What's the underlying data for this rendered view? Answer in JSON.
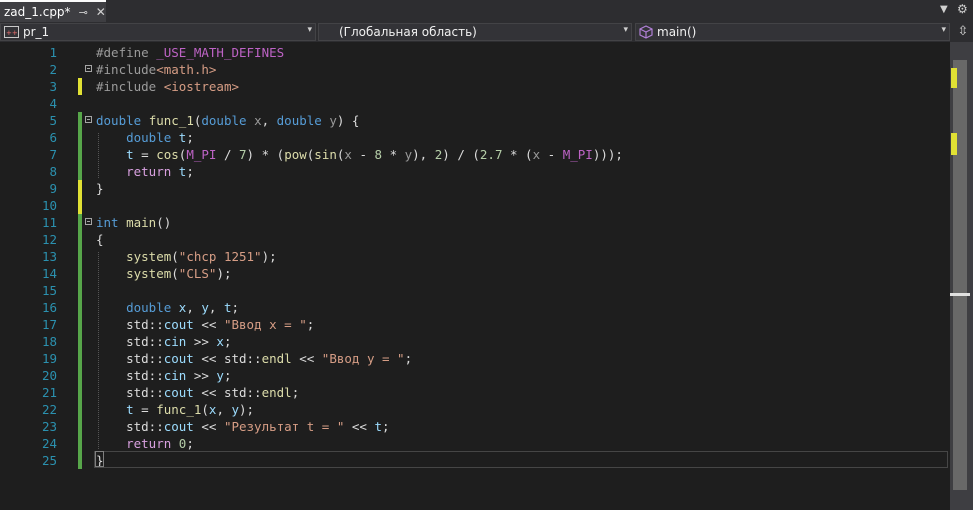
{
  "tab": {
    "title": "zad_1.cpp*",
    "pin_glyph": "⊸",
    "close_glyph": "✕"
  },
  "tab_controls": {
    "dropdown_glyph": "▼",
    "settings_glyph": "⚙"
  },
  "navbar": {
    "project": "pr_1",
    "scope": "(Глобальная область)",
    "member": "main()",
    "arrow_glyph": "▾",
    "split_glyph": "⇳"
  },
  "code_lines": [
    [
      {
        "t": "#define ",
        "c": "pp"
      },
      {
        "t": "_USE_MATH_DEFINES",
        "c": "mac"
      }
    ],
    [
      {
        "t": "#include",
        "c": "pp"
      },
      {
        "t": "<math.h>",
        "c": "inc"
      }
    ],
    [
      {
        "t": "#include ",
        "c": "pp"
      },
      {
        "t": "<iostream>",
        "c": "inc"
      }
    ],
    [],
    [
      {
        "t": "double ",
        "c": "kw"
      },
      {
        "t": "func_1",
        "c": "fn"
      },
      {
        "t": "("
      },
      {
        "t": "double ",
        "c": "kw"
      },
      {
        "t": "x",
        "c": "prm"
      },
      {
        "t": ", "
      },
      {
        "t": "double ",
        "c": "kw"
      },
      {
        "t": "y",
        "c": "prm"
      },
      {
        "t": ") {"
      }
    ],
    [
      {
        "t": "    "
      },
      {
        "t": "double ",
        "c": "kw"
      },
      {
        "t": "t",
        "c": "var"
      },
      {
        "t": ";"
      }
    ],
    [
      {
        "t": "    "
      },
      {
        "t": "t",
        "c": "var"
      },
      {
        "t": " = "
      },
      {
        "t": "cos",
        "c": "fn"
      },
      {
        "t": "("
      },
      {
        "t": "M_PI",
        "c": "mac"
      },
      {
        "t": " / "
      },
      {
        "t": "7",
        "c": "num"
      },
      {
        "t": ") * ("
      },
      {
        "t": "pow",
        "c": "fn"
      },
      {
        "t": "("
      },
      {
        "t": "sin",
        "c": "fn"
      },
      {
        "t": "("
      },
      {
        "t": "x",
        "c": "prm"
      },
      {
        "t": " - "
      },
      {
        "t": "8",
        "c": "num"
      },
      {
        "t": " * "
      },
      {
        "t": "y",
        "c": "prm"
      },
      {
        "t": "), "
      },
      {
        "t": "2",
        "c": "num"
      },
      {
        "t": ") / ("
      },
      {
        "t": "2.7",
        "c": "num"
      },
      {
        "t": " * ("
      },
      {
        "t": "x",
        "c": "prm"
      },
      {
        "t": " - "
      },
      {
        "t": "M_PI",
        "c": "mac"
      },
      {
        "t": ")));"
      }
    ],
    [
      {
        "t": "    "
      },
      {
        "t": "return ",
        "c": "ctl"
      },
      {
        "t": "t",
        "c": "var"
      },
      {
        "t": ";"
      }
    ],
    [
      {
        "t": "}"
      }
    ],
    [],
    [
      {
        "t": "int ",
        "c": "kw"
      },
      {
        "t": "main",
        "c": "fn"
      },
      {
        "t": "()"
      }
    ],
    [
      {
        "t": "{"
      }
    ],
    [
      {
        "t": "    "
      },
      {
        "t": "system",
        "c": "fn"
      },
      {
        "t": "("
      },
      {
        "t": "\"chcp 1251\"",
        "c": "str"
      },
      {
        "t": ");"
      }
    ],
    [
      {
        "t": "    "
      },
      {
        "t": "system",
        "c": "fn"
      },
      {
        "t": "("
      },
      {
        "t": "\"CLS\"",
        "c": "str"
      },
      {
        "t": ");"
      }
    ],
    [],
    [
      {
        "t": "    "
      },
      {
        "t": "double ",
        "c": "kw"
      },
      {
        "t": "x",
        "c": "var"
      },
      {
        "t": ", "
      },
      {
        "t": "y",
        "c": "var"
      },
      {
        "t": ", "
      },
      {
        "t": "t",
        "c": "var"
      },
      {
        "t": ";"
      }
    ],
    [
      {
        "t": "    std::"
      },
      {
        "t": "cout",
        "c": "var"
      },
      {
        "t": " << "
      },
      {
        "t": "\"Ввод x = \"",
        "c": "str"
      },
      {
        "t": ";"
      }
    ],
    [
      {
        "t": "    std::"
      },
      {
        "t": "cin",
        "c": "var"
      },
      {
        "t": " >> "
      },
      {
        "t": "x",
        "c": "var"
      },
      {
        "t": ";"
      }
    ],
    [
      {
        "t": "    std::"
      },
      {
        "t": "cout",
        "c": "var"
      },
      {
        "t": " << std::"
      },
      {
        "t": "endl",
        "c": "fn"
      },
      {
        "t": " << "
      },
      {
        "t": "\"Ввод y = \"",
        "c": "str"
      },
      {
        "t": ";"
      }
    ],
    [
      {
        "t": "    std::"
      },
      {
        "t": "cin",
        "c": "var"
      },
      {
        "t": " >> "
      },
      {
        "t": "y",
        "c": "var"
      },
      {
        "t": ";"
      }
    ],
    [
      {
        "t": "    std::"
      },
      {
        "t": "cout",
        "c": "var"
      },
      {
        "t": " << std::"
      },
      {
        "t": "endl",
        "c": "fn"
      },
      {
        "t": ";"
      }
    ],
    [
      {
        "t": "    "
      },
      {
        "t": "t",
        "c": "var"
      },
      {
        "t": " = "
      },
      {
        "t": "func_1",
        "c": "fn"
      },
      {
        "t": "("
      },
      {
        "t": "x",
        "c": "var"
      },
      {
        "t": ", "
      },
      {
        "t": "y",
        "c": "var"
      },
      {
        "t": ");"
      }
    ],
    [
      {
        "t": "    std::"
      },
      {
        "t": "cout",
        "c": "var"
      },
      {
        "t": " << "
      },
      {
        "t": "\"Результат t = \"",
        "c": "str"
      },
      {
        "t": " << "
      },
      {
        "t": "t",
        "c": "var"
      },
      {
        "t": ";"
      }
    ],
    [
      {
        "t": "    "
      },
      {
        "t": "return ",
        "c": "ctl"
      },
      {
        "t": "0",
        "c": "num"
      },
      {
        "t": ";"
      }
    ],
    [
      {
        "t": "}"
      }
    ]
  ],
  "folded_lines": [
    2,
    5,
    11
  ],
  "change_marks": {
    "3": "#e1e134",
    "5": "#57a64a",
    "6": "#57a64a",
    "7": "#57a64a",
    "8": "#57a64a",
    "9": "#e1e134",
    "10": "#e1e134",
    "11": "#57a64a",
    "12": "#57a64a",
    "13": "#57a64a",
    "14": "#57a64a",
    "15": "#57a64a",
    "16": "#57a64a",
    "17": "#57a64a",
    "18": "#57a64a",
    "19": "#57a64a",
    "20": "#57a64a",
    "21": "#57a64a",
    "22": "#57a64a",
    "23": "#57a64a",
    "24": "#57a64a",
    "25": "#57a64a"
  },
  "colors": {
    "keyword": "#569cd6",
    "preprocessor": "#9b9b9b",
    "macro": "#bd63c5",
    "string": "#d69d85",
    "number": "#b5cea8",
    "function": "#dcdcaa",
    "variable": "#9cdcfe",
    "parameter": "#9a9a9a",
    "control": "#d8a0df",
    "saved_change": "#57a64a",
    "unsaved_change": "#e1e134"
  },
  "icons": {
    "project_icon": "cpp-project-icon",
    "member_icon": "cube-icon",
    "split_icon": "split-window-icon"
  }
}
